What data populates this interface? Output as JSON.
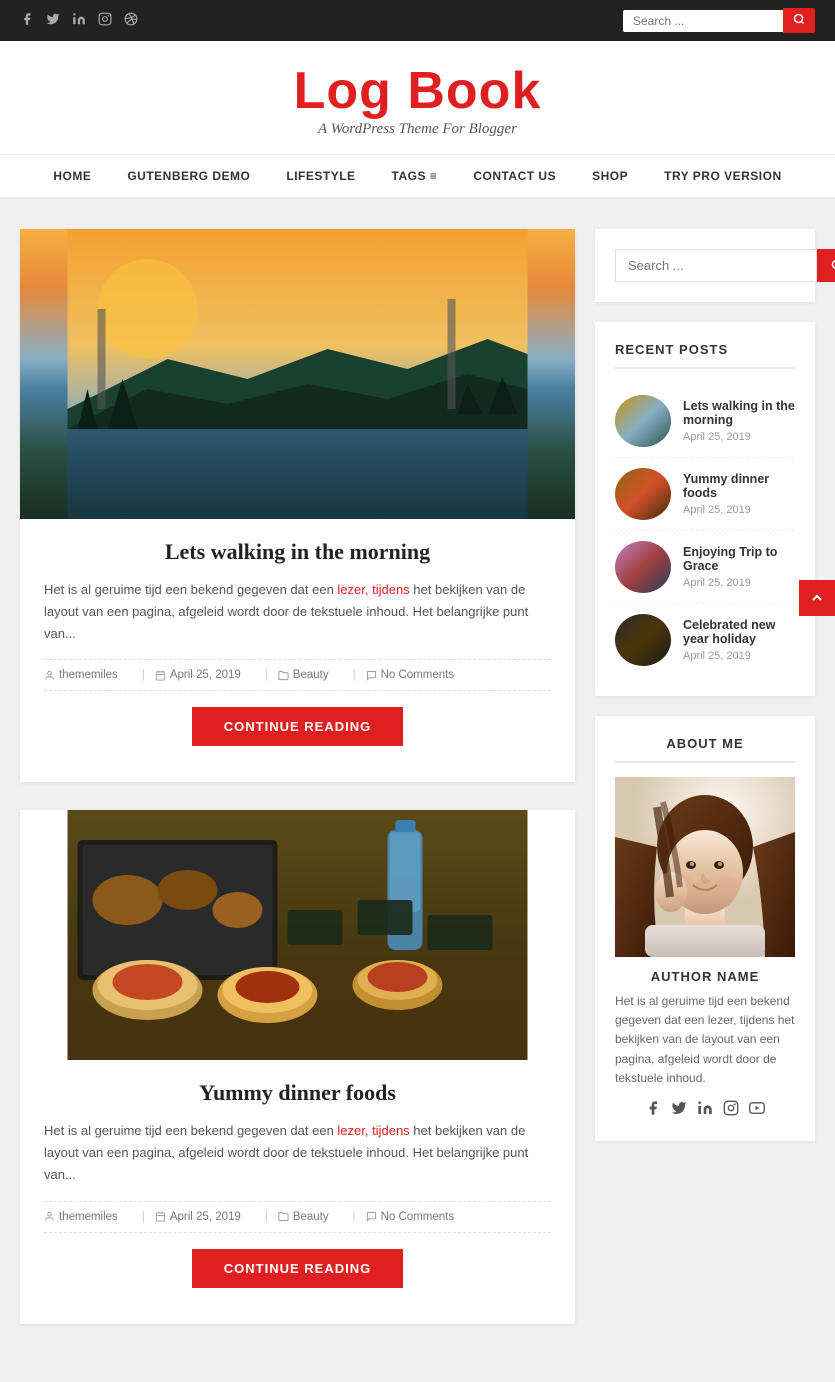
{
  "topbar": {
    "social": [
      {
        "name": "facebook",
        "icon": "f"
      },
      {
        "name": "twitter",
        "icon": "t"
      },
      {
        "name": "linkedin",
        "icon": "in"
      },
      {
        "name": "instagram",
        "icon": "ig"
      },
      {
        "name": "dribbble",
        "icon": "d"
      }
    ],
    "search_placeholder": "Search ..."
  },
  "header": {
    "title": "Log Book",
    "tagline": "A WordPress Theme For Blogger"
  },
  "nav": {
    "items": [
      {
        "label": "HOME",
        "has_dropdown": false
      },
      {
        "label": "GUTENBERG DEMO",
        "has_dropdown": false
      },
      {
        "label": "LIFESTYLE",
        "has_dropdown": false
      },
      {
        "label": "TAGS ≡",
        "has_dropdown": true
      },
      {
        "label": "CONTACT US",
        "has_dropdown": false
      },
      {
        "label": "SHOP",
        "has_dropdown": false
      },
      {
        "label": "TRY PRO VERSION",
        "has_dropdown": false
      }
    ]
  },
  "posts": [
    {
      "id": 1,
      "title": "Lets walking in the morning",
      "excerpt": "Het is al geruime tijd een bekend gegeven dat een lezer, tijdens het bekijken van de layout van een pagina, afgeleid wordt door de tekstuele inhoud. Het belangrijke punt van...",
      "author": "thememiles",
      "date": "April 25, 2019",
      "category": "Beauty",
      "comments": "No Comments",
      "continue_label": "CONTINUE READING"
    },
    {
      "id": 2,
      "title": "Yummy dinner foods",
      "excerpt": "Het is al geruime tijd een bekend gegeven dat een lezer, tijdens het bekijken van de layout van een pagina, afgeleid wordt door de tekstuele inhoud. Het belangrijke punt van...",
      "author": "thememiles",
      "date": "April 25, 2019",
      "category": "Beauty",
      "comments": "No Comments",
      "continue_label": "CONTINUE READING"
    }
  ],
  "sidebar": {
    "search_placeholder": "Search ...",
    "recent_posts_title": "RECENT POSTS",
    "recent_posts": [
      {
        "title": "Lets walking in the morning",
        "date": "April 25, 2019"
      },
      {
        "title": "Yummy dinner foods",
        "date": "April 25, 2019"
      },
      {
        "title": "Enjoying Trip to Grace",
        "date": "April 25, 2019"
      },
      {
        "title": "Celebrated new year holiday",
        "date": "April 25, 2019"
      }
    ],
    "about_title": "ABOUT ME",
    "author_name": "AUTHOR NAME",
    "author_bio": "Het is al geruime tijd een bekend gegeven dat een lezer, tijdens het bekijken van de layout van een pagina, afgeleid wordt door de tekstuele inhoud.",
    "about_social": [
      {
        "name": "facebook",
        "icon": "f"
      },
      {
        "name": "twitter",
        "icon": "t"
      },
      {
        "name": "linkedin",
        "icon": "in"
      },
      {
        "name": "instagram",
        "icon": "ig"
      },
      {
        "name": "youtube",
        "icon": "▶"
      }
    ]
  }
}
